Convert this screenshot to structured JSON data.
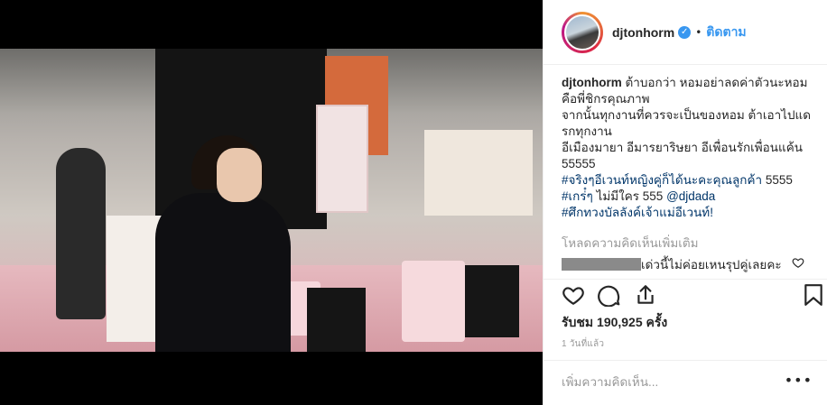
{
  "post": {
    "username": "djtonhorm",
    "verified_icon": "verified-badge-icon",
    "separator": "•",
    "follow_label": "ติดตาม"
  },
  "caption": {
    "username": "djtonhorm",
    "line1_rest": " ต้าบอกว่า หอมอย่าลดค่าตัวนะหอม",
    "line2": "คือพี่ชิกรคุณภาพ",
    "line3": "จากนั้นทุกงานที่ควรจะเป็นของหอม ต้าเอาไปแด",
    "line4": "รกทุกงาน",
    "line5": "อีเมืองมายา อีมารยาริษยา อีเพื่อนรักเพื่อนแค้น",
    "line6": "55555",
    "line7_tag": "#จริงๆอีเวนท์หญิงคู่ก็ได้นะคะคุณลูกค้า",
    "line7_rest": " 5555",
    "line8_tag": "#เกร่๋ๆ",
    "line8_mid": " ไม่มีใคร 555 ",
    "line8_mention": "@djdada",
    "line9_tag": "#ศึกทวงบัลลังค์เจ้าแม่อีเวนท์!"
  },
  "comments": {
    "load_more": "โหลดความคิดเห็นเพิ่มเติม",
    "first_comment_text": "เด่วนี้ไม่ค่อยเหนรุปคู่เลยคะ"
  },
  "actions": {
    "like_icon": "heart-icon",
    "comment_icon": "comment-icon",
    "share_icon": "share-icon",
    "save_icon": "bookmark-icon"
  },
  "stats": {
    "likes_text": "รับชม 190,925 ครั้ง",
    "time_text": "1 วันที่แล้ว"
  },
  "composer": {
    "placeholder": "เพิ่มความคิดเห็น...",
    "more_label": "•••"
  }
}
